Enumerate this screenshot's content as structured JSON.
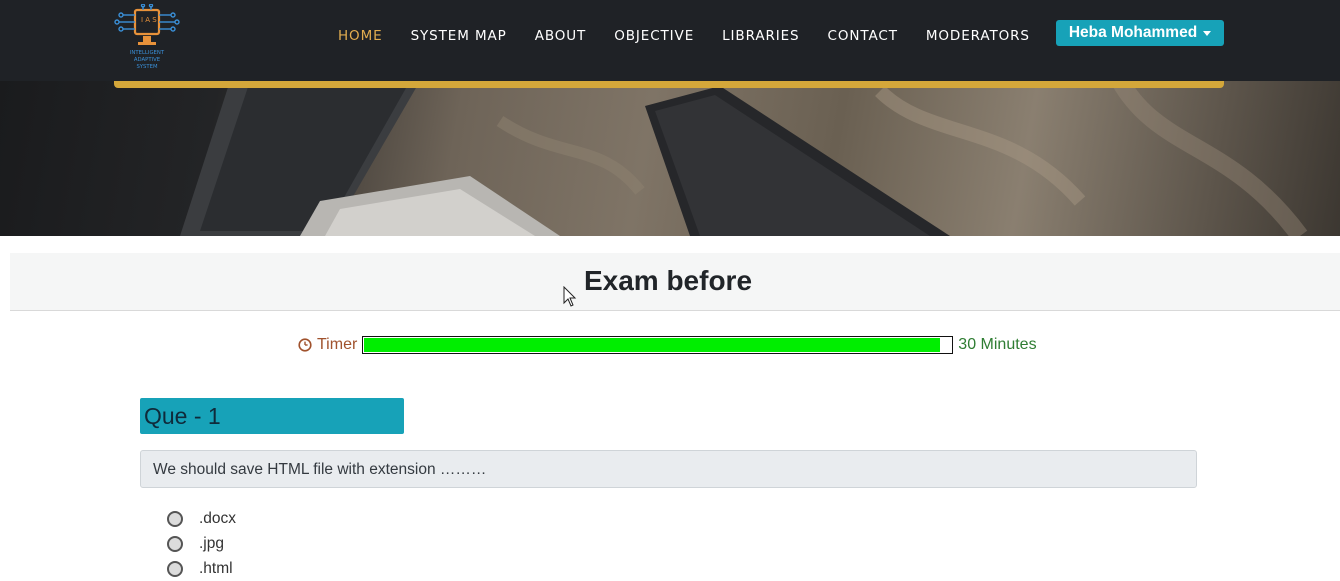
{
  "logo": {
    "letters": "I A S",
    "line1": "INTELLIGENT",
    "line2": "ADAPTIVE",
    "line3": "SYSTEM"
  },
  "nav": {
    "items": [
      {
        "label": "HOME",
        "active": true
      },
      {
        "label": "SYSTEM MAP"
      },
      {
        "label": "ABOUT"
      },
      {
        "label": "OBJECTIVE"
      },
      {
        "label": "LIBRARIES"
      },
      {
        "label": "CONTACT"
      },
      {
        "label": "MODERATORS"
      }
    ],
    "user": "Heba Mohammed"
  },
  "exam": {
    "title": "Exam before"
  },
  "timer": {
    "label": "Timer",
    "remaining": "30 Minutes",
    "progress_percent": 98,
    "fill_color": "#00ee00"
  },
  "question": {
    "badge": "Que - 1",
    "text": "We should save HTML file with extension ………",
    "options": [
      ".docx",
      ".jpg",
      ".html"
    ]
  },
  "colors": {
    "navbar": "#1f2226",
    "accent": "#17a2b8",
    "active_nav": "#e2ad4f",
    "gold_bar": "#d4a73a"
  },
  "icons": [
    "logo-icon",
    "clock-icon",
    "cursor-icon",
    "caret-down-icon"
  ]
}
